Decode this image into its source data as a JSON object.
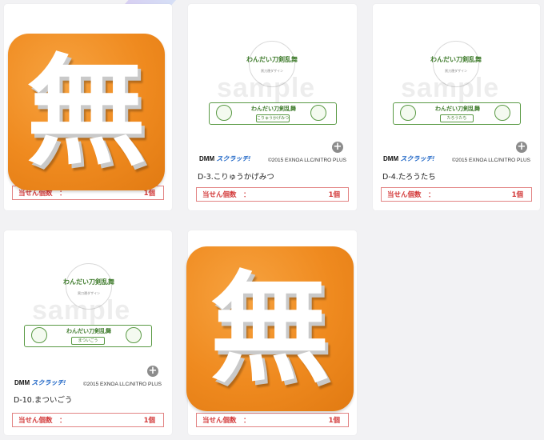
{
  "cards": [
    {
      "id": "D-?",
      "name": "",
      "count_label": "当せん個数　：",
      "count_value": "1個",
      "icon": "mu-icon",
      "icon_glyph": "無",
      "has_plus": false
    },
    {
      "id": "D-3",
      "name": "D-3.こりゅうかげみつ",
      "count_label": "当せん個数　：",
      "count_value": "1個",
      "thumb": "sample-thumbnail",
      "band_tag": "こりゅうかげみつ"
    },
    {
      "id": "D-4",
      "name": "D-4.たろうたち",
      "count_label": "当せん個数　：",
      "count_value": "1個",
      "thumb": "sample-thumbnail",
      "band_tag": "たろうたち"
    },
    {
      "id": "D-10",
      "name": "D-10.まついごう",
      "count_label": "当せん個数　：",
      "count_value": "1個",
      "thumb": "sample-thumbnail",
      "band_tag": "まついごう"
    },
    {
      "id": "D-?2",
      "name": "",
      "count_label": "当せん個数　：",
      "count_value": "1個",
      "icon": "mu-icon",
      "icon_glyph": "無",
      "has_plus": false
    }
  ],
  "thumb_text": {
    "circle_title": "わんだい刀剣乱舞",
    "circle_sub": "黒刀運ダザイン",
    "band_title": "わんだい刀剣乱舞",
    "watermark": "sample",
    "dmm_logo": "DMM",
    "kuji_logo": "スクラッチ!",
    "copyright": "©2015 EXNOA LLC/NITRO PLUS",
    "plus_symbol": "+"
  },
  "colors": {
    "icon_orange": "#ef8a1f",
    "count_border": "#e28383",
    "count_text": "#d33b3b",
    "band_green": "#5a9a45"
  }
}
